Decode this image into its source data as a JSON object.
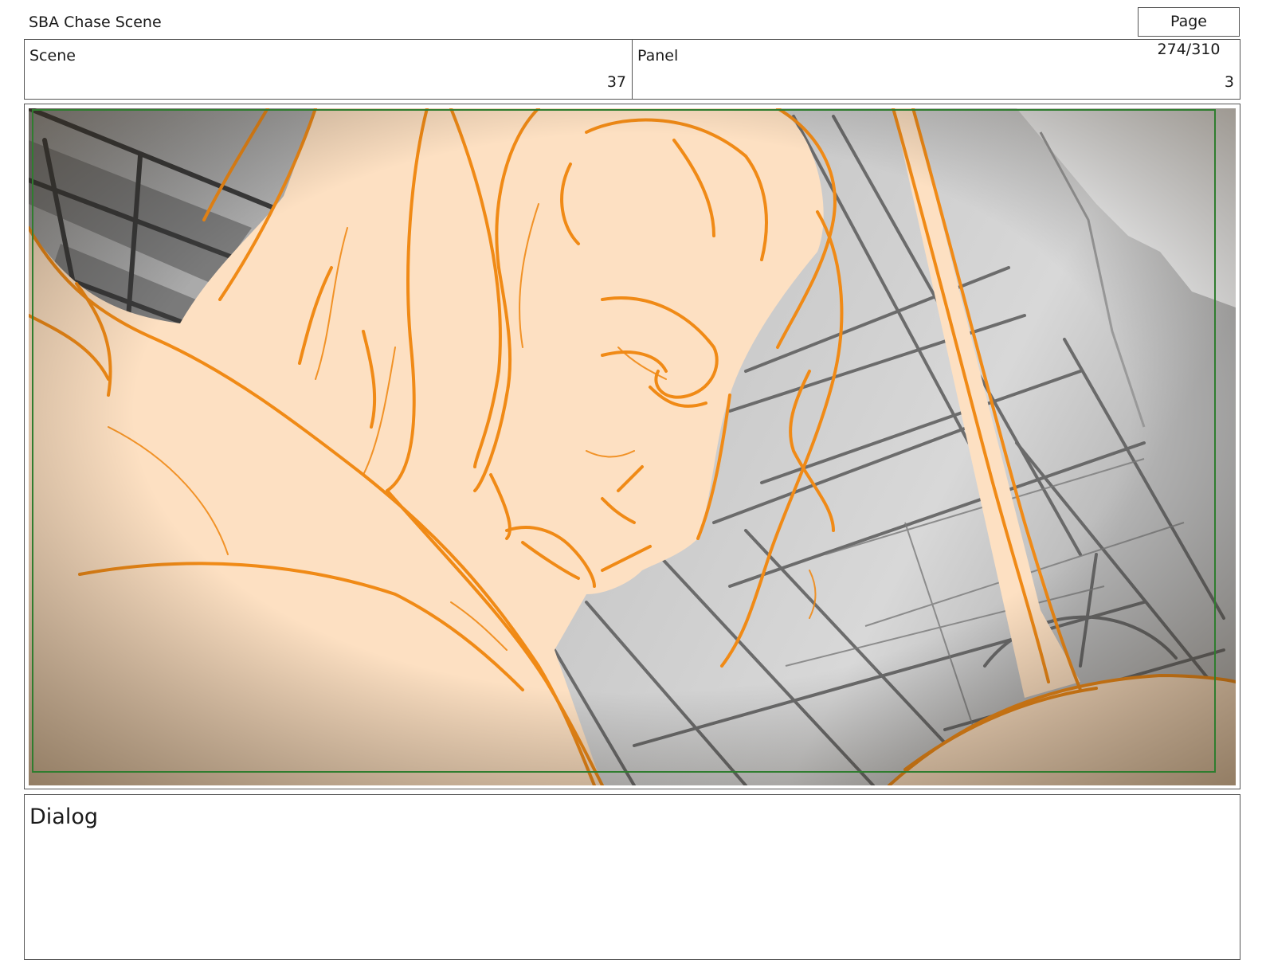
{
  "header": {
    "title": "SBA Chase Scene",
    "page": "Page 274/310"
  },
  "scene": {
    "label": "Scene",
    "value": "37"
  },
  "panel": {
    "label": "Panel",
    "value": "3"
  },
  "dialog": {
    "label": "Dialog"
  },
  "colors": {
    "sketch_line": "#f08a16",
    "skin_fill": "#fde0c2",
    "safe_frame": "#2f7d2f",
    "background_gray": "#c8c8c8"
  }
}
